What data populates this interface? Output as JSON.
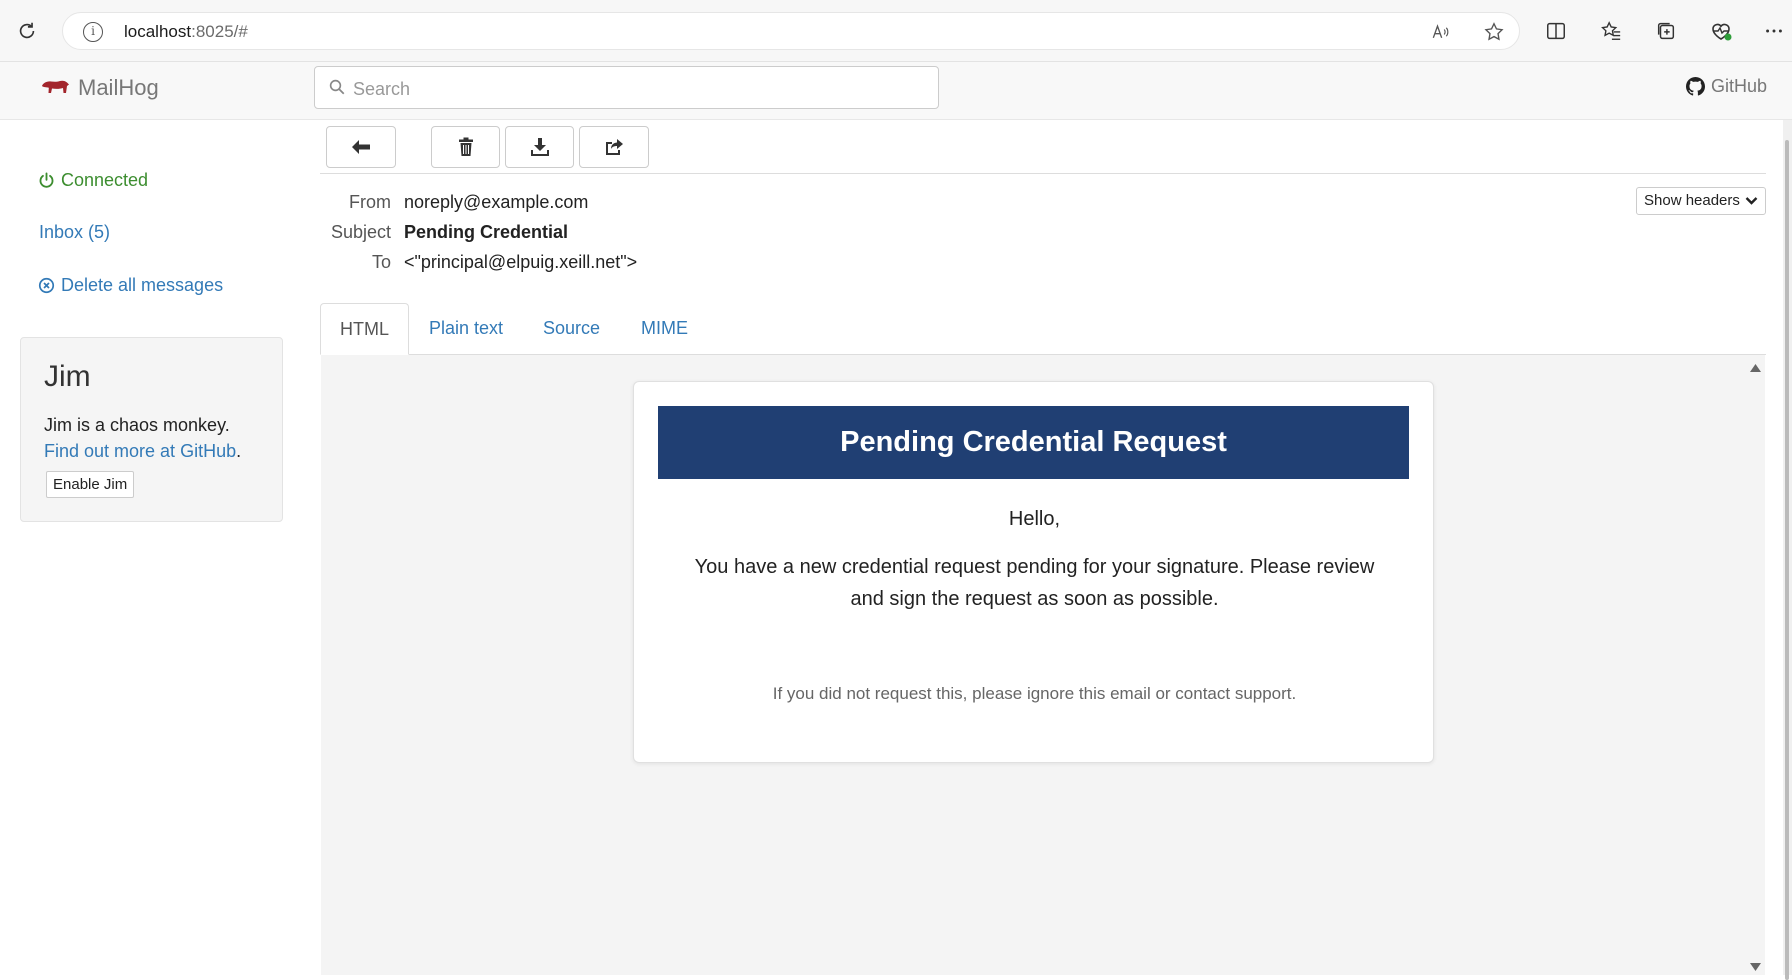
{
  "browser": {
    "url_host": "localhost",
    "url_rest": ":8025/#"
  },
  "navbar": {
    "brand": "MailHog",
    "search_placeholder": "Search",
    "github_label": "GitHub"
  },
  "sidebar": {
    "connected": "Connected",
    "inbox": "Inbox (5)",
    "delete_all": "Delete all messages",
    "jim": {
      "title": "Jim",
      "text": "Jim is a chaos monkey.",
      "link": "Find out more at GitHub",
      "link_suffix": ".",
      "button": "Enable Jim"
    }
  },
  "message": {
    "labels": {
      "from": "From",
      "subject": "Subject",
      "to": "To"
    },
    "from": "noreply@example.com",
    "subject": "Pending Credential",
    "to": "<\"principal@elpuig.xeill.net\">",
    "show_headers": "Show headers"
  },
  "tabs": [
    {
      "label": "HTML",
      "active": true
    },
    {
      "label": "Plain text",
      "active": false
    },
    {
      "label": "Source",
      "active": false
    },
    {
      "label": "MIME",
      "active": false
    }
  ],
  "email": {
    "banner": "Pending Credential Request",
    "greeting": "Hello,",
    "body": "You have a new credential request pending for your signature. Please review and sign the request as soon as possible.",
    "footer": "If you did not request this, please ignore this email or contact support."
  },
  "colors": {
    "link": "#337ab7",
    "connected": "#3c8d2f",
    "banner": "#203f73",
    "brand_logo": "#a3252c"
  }
}
